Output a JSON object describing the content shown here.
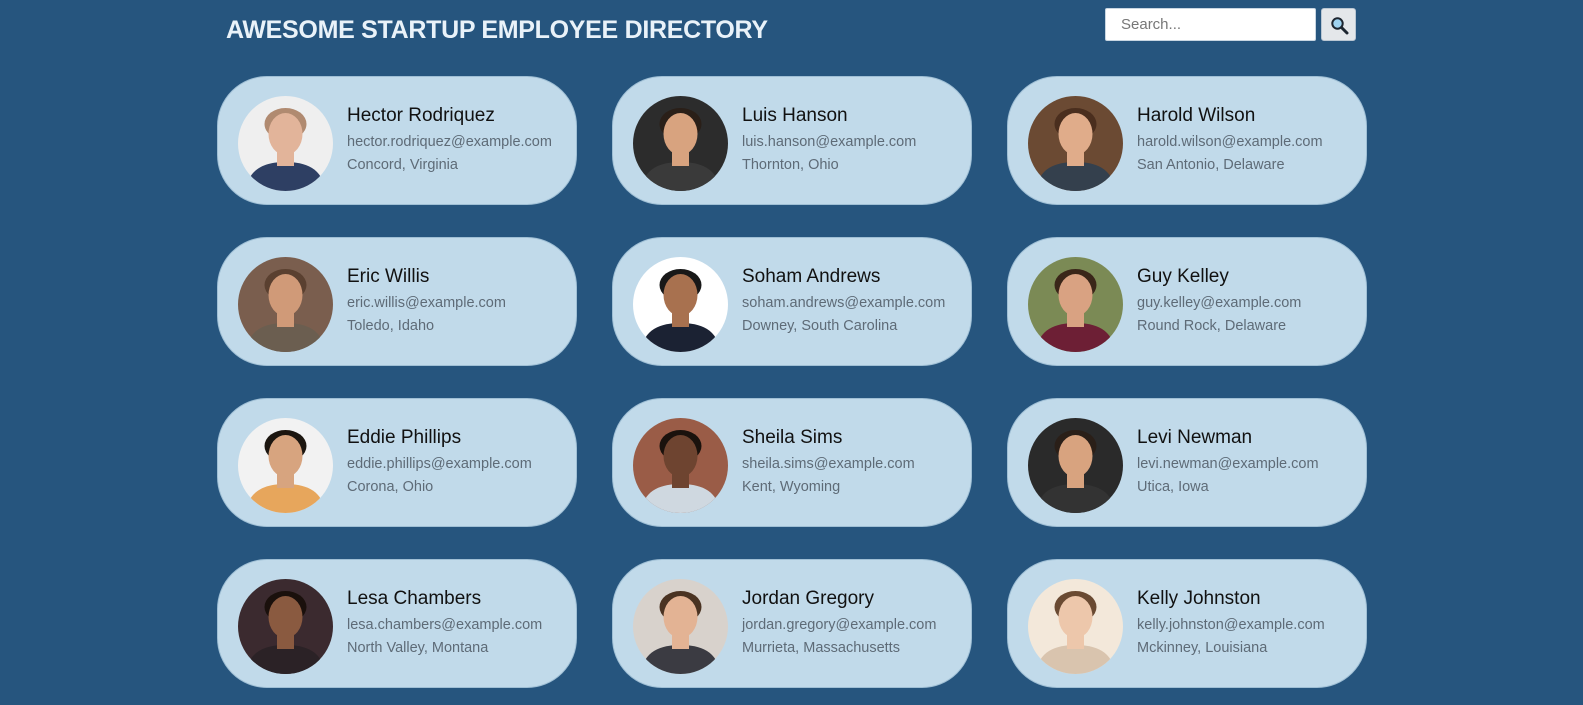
{
  "header": {
    "title": "AWESOME STARTUP EMPLOYEE DIRECTORY"
  },
  "search": {
    "placeholder": "Search...",
    "value": "",
    "button_icon": "magnifying-glass-icon"
  },
  "employees": [
    {
      "name": "Hector Rodriquez",
      "email": "hector.rodriquez@example.com",
      "location": "Concord, Virginia",
      "skin": "#e2b49a",
      "hair": "#b08a70",
      "bg": "#efefef",
      "shirt": "#2e3f63"
    },
    {
      "name": "Luis Hanson",
      "email": "luis.hanson@example.com",
      "location": "Thornton, Ohio",
      "skin": "#d8a37f",
      "hair": "#2a1f18",
      "bg": "#2c2c2c",
      "shirt": "#3a3a3a"
    },
    {
      "name": "Harold Wilson",
      "email": "harold.wilson@example.com",
      "location": "San Antonio, Delaware",
      "skin": "#e0ac8a",
      "hair": "#4a2e1e",
      "bg": "#6b4a33",
      "shirt": "#34404d"
    },
    {
      "name": "Eric Willis",
      "email": "eric.willis@example.com",
      "location": "Toledo, Idaho",
      "skin": "#d09a78",
      "hair": "#5a4030",
      "bg": "#7a5e4e",
      "shirt": "#6b5e50"
    },
    {
      "name": "Soham Andrews",
      "email": "soham.andrews@example.com",
      "location": "Downey, South Carolina",
      "skin": "#a8714f",
      "hair": "#181818",
      "bg": "#ffffff",
      "shirt": "#1b2233"
    },
    {
      "name": "Guy Kelley",
      "email": "guy.kelley@example.com",
      "location": "Round Rock, Delaware",
      "skin": "#d9a282",
      "hair": "#3a2619",
      "bg": "#7b8a55",
      "shirt": "#6d1f35"
    },
    {
      "name": "Eddie Phillips",
      "email": "eddie.phillips@example.com",
      "location": "Corona, Ohio",
      "skin": "#d7a47f",
      "hair": "#1c1610",
      "bg": "#f2f2f2",
      "shirt": "#e7a65c"
    },
    {
      "name": "Sheila Sims",
      "email": "sheila.sims@example.com",
      "location": "Kent, Wyoming",
      "skin": "#6e4430",
      "hair": "#1a120d",
      "bg": "#9a5c47",
      "shirt": "#cfd8e0"
    },
    {
      "name": "Levi Newman",
      "email": "levi.newman@example.com",
      "location": "Utica, Iowa",
      "skin": "#d8a37f",
      "hair": "#2a1f18",
      "bg": "#2a2a2a",
      "shirt": "#333333"
    },
    {
      "name": "Lesa Chambers",
      "email": "lesa.chambers@example.com",
      "location": "North Valley, Montana",
      "skin": "#8a5a40",
      "hair": "#1a100c",
      "bg": "#3b2a2f",
      "shirt": "#2b2226"
    },
    {
      "name": "Jordan Gregory",
      "email": "jordan.gregory@example.com",
      "location": "Murrieta, Massachusetts",
      "skin": "#e3b394",
      "hair": "#4a3322",
      "bg": "#d8d2cc",
      "shirt": "#3b3b42"
    },
    {
      "name": "Kelly Johnston",
      "email": "kelly.johnston@example.com",
      "location": "Mckinney, Louisiana",
      "skin": "#edc7ab",
      "hair": "#6a4a32",
      "bg": "#f3e8da",
      "shirt": "#d9c4ae"
    }
  ]
}
